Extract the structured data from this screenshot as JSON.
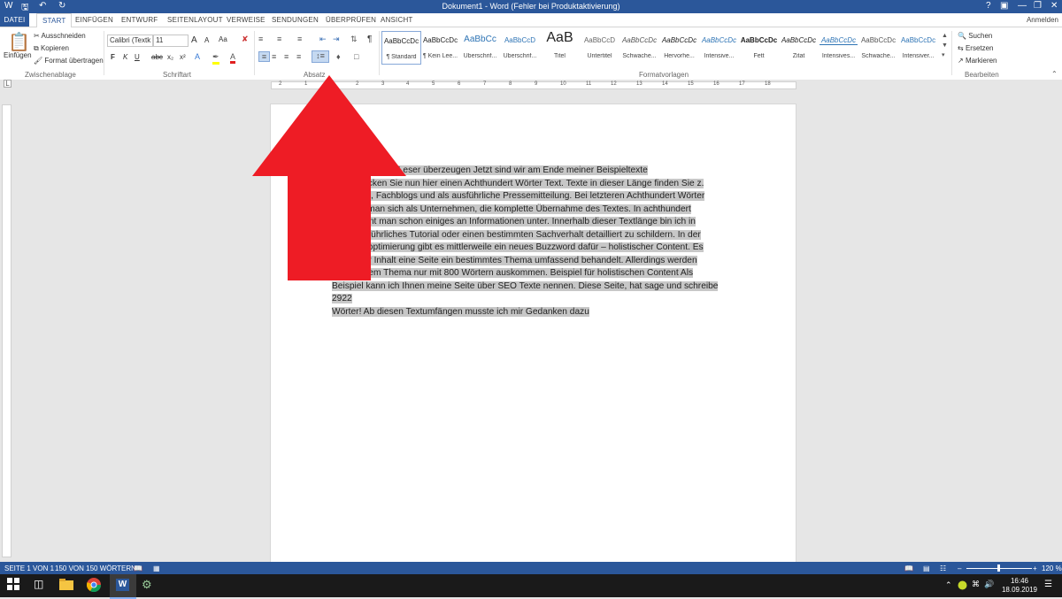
{
  "window": {
    "title": "Dokument1 - Word (Fehler bei Produktaktivierung)",
    "help": "?",
    "minimize": "—",
    "restore": "❐",
    "close": "✕"
  },
  "tabs": {
    "file": "DATEI",
    "items": [
      "START",
      "EINFÜGEN",
      "ENTWURF",
      "SEITENLAYOUT",
      "VERWEISE",
      "SENDUNGEN",
      "ÜBERPRÜFEN",
      "ANSICHT"
    ],
    "signin": "Anmelden"
  },
  "clipboard": {
    "paste": "Einfügen",
    "cut": "Ausschneiden",
    "copy": "Kopieren",
    "format_painter": "Format übertragen",
    "label": "Zwischenablage"
  },
  "font": {
    "family": "Calibri (Textk",
    "size": "11",
    "bold": "F",
    "italic": "K",
    "underline": "U",
    "strike": "abc",
    "subscript": "x₂",
    "superscript": "x²",
    "case": "Aa",
    "grow": "A",
    "shrink": "A",
    "label": "Schriftart"
  },
  "paragraph": {
    "label": "Absatz",
    "pilcrow": "¶"
  },
  "styles": {
    "label": "Formatvorlagen",
    "items": [
      {
        "preview": "AaBbCcDc",
        "name": "¶ Standard"
      },
      {
        "preview": "AaBbCcDc",
        "name": "¶ Kein Lee..."
      },
      {
        "preview": "AaBbCc",
        "name": "Überschrif..."
      },
      {
        "preview": "AaBbCcD",
        "name": "Überschrif..."
      },
      {
        "preview": "AaB",
        "name": "Titel"
      },
      {
        "preview": "AaBbCcD",
        "name": "Untertitel"
      },
      {
        "preview": "AaBbCcDc",
        "name": "Schwache..."
      },
      {
        "preview": "AaBbCcDc",
        "name": "Hervorhe..."
      },
      {
        "preview": "AaBbCcDc",
        "name": "Intensive..."
      },
      {
        "preview": "AaBbCcDc",
        "name": "Fett"
      },
      {
        "preview": "AaBbCcDc",
        "name": "Zitat"
      },
      {
        "preview": "AaBbCcDc",
        "name": "Intensives..."
      },
      {
        "preview": "AaBbCcDc",
        "name": "Schwache..."
      },
      {
        "preview": "AaBbCcDc",
        "name": "Intensiver..."
      }
    ]
  },
  "editing": {
    "find": "Suchen",
    "replace": "Ersetzen",
    "select": "Markieren",
    "label": "Bearbeiten"
  },
  "ruler": {
    "marks": [
      "2",
      "1",
      "1",
      "2",
      "3",
      "4",
      "5",
      "6",
      "7",
      "8",
      "9",
      "10",
      "11",
      "12",
      "13",
      "14",
      "15",
      "16",
      "17",
      "18"
    ]
  },
  "document": {
    "lines": [
      "n und mehr Ihre Leser überzeugen Jetzt sind wir am Ende meiner Beispieltexte",
      "gt. Entdecken Sie nun hier einen Achthundert Wörter Text. Texte in dieser Länge finden Sie z.",
      "Wikipedia, Fachblogs und als ausführliche Pressemitteilung. Bei letzteren Achthundert Wörter",
      "wünscht man sich als Unternehmen, die komplette Übernahme des Textes. In achthundert",
      "n bekommt man schon einiges an Informationen unter. Innerhalb dieser Textlänge bin ich in",
      "e ein ausführliches Tutorial oder einen bestimmten Sachverhalt detailliert zu schildern. In der",
      "aschinenoptimierung gibt es mittlerweile ein neues Buzzword dafür – holistischer Content. Es",
      "s, das der Inhalt eine Seite ein bestimmtes Thema umfassend behandelt. Allerdings werden",
      "nt bei jedem Thema nur mit 800 Wörtern auskommen. Beispiel für holistischen Content Als",
      "Beispiel kann ich Ihnen meine Seite über SEO Texte nennen. Diese Seite, hat sage und schreibe 2922",
      "Wörter! Ab diesen Textumfängen musste ich mir Gedanken dazu"
    ]
  },
  "status": {
    "page": "SEITE 1 VON 1",
    "words": "150 VON 150 WÖRTERN",
    "zoom": "120 %"
  },
  "taskbar": {
    "time": "16:46",
    "date": "18.09.2019"
  },
  "colors": {
    "word_blue": "#2b579a",
    "arrow_red": "#ee1c25",
    "selection_gray": "#c7c7c7"
  }
}
